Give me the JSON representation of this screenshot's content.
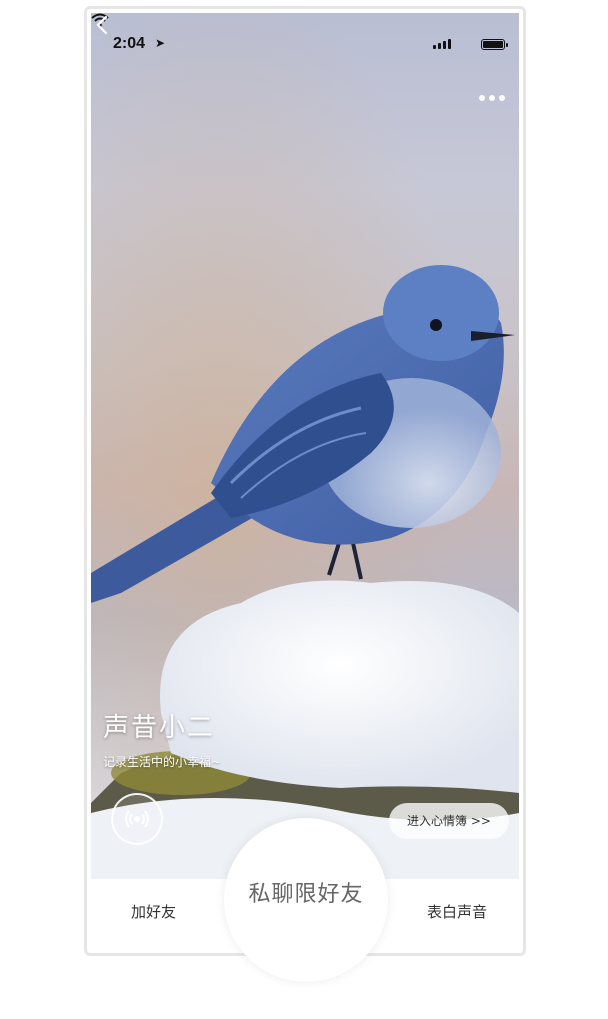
{
  "status_bar": {
    "time": "2:04"
  },
  "profile": {
    "name": "声昔小二",
    "tagline": "记录生活中的小幸福~"
  },
  "actions": {
    "enter_mood": "进入心情簿 >>"
  },
  "bottom_bar": {
    "add_friend": "加好友",
    "private_chat": "私聊限好友",
    "confess_voice": "表白声音"
  },
  "colors": {
    "accent": "#ffffff",
    "text_dark": "#333333"
  },
  "icons": [
    "back-icon",
    "more-icon",
    "location-arrow-icon",
    "signal-icon",
    "wifi-icon",
    "battery-icon",
    "broadcast-icon"
  ]
}
